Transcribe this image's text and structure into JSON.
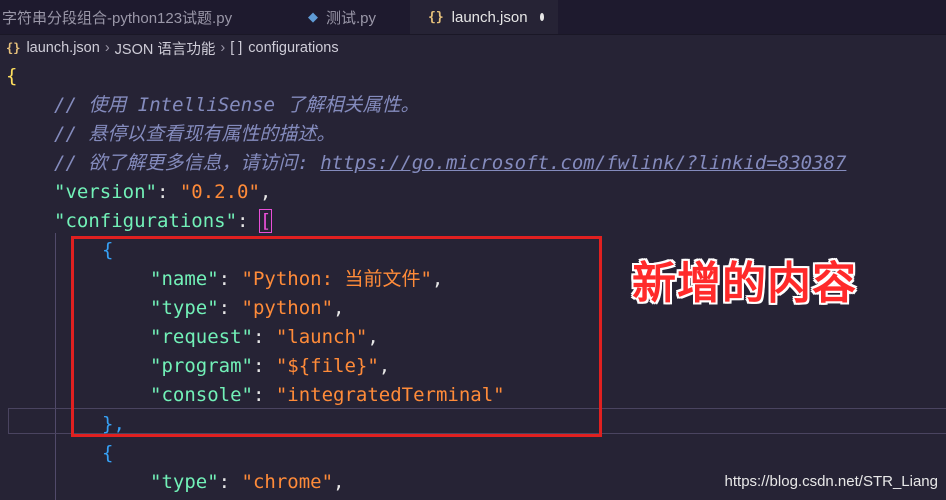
{
  "tabs": [
    {
      "icon": "python-icon",
      "label": "字符串分段组合-python123试题.py",
      "active": false
    },
    {
      "icon": "python-icon",
      "label": "测试.py",
      "active": false
    },
    {
      "icon": "json-icon",
      "label": "launch.json",
      "active": true,
      "unsaved": true
    }
  ],
  "breadcrumb": {
    "file": "launch.json",
    "segment2": "JSON 语言功能",
    "segment3_icon": "[ ]",
    "segment3": "configurations"
  },
  "code": {
    "open_brace": "{",
    "comment1": "// 使用 IntelliSense 了解相关属性。",
    "comment2": "// 悬停以查看现有属性的描述。",
    "comment3_prefix": "// 欲了解更多信息，请访问: ",
    "comment3_link": "https://go.microsoft.com/fwlink/?linkid=830387",
    "version_key": "\"version\"",
    "version_value": "\"0.2.0\"",
    "configurations_key": "\"configurations\"",
    "open_bracket": "[",
    "obj1": {
      "open": "{",
      "name_key": "\"name\"",
      "name_value": "\"Python: 当前文件\"",
      "type_key": "\"type\"",
      "type_value": "\"python\"",
      "request_key": "\"request\"",
      "request_value": "\"launch\"",
      "program_key": "\"program\"",
      "program_value": "\"${file}\"",
      "console_key": "\"console\"",
      "console_value": "\"integratedTerminal\"",
      "close": "},"
    },
    "obj2": {
      "open": "{",
      "type_key": "\"type\"",
      "type_value": "\"chrome\""
    }
  },
  "annotation": "新增的内容",
  "watermark": "https://blog.csdn.net/STR_Liang",
  "colors": {
    "background": "#262335",
    "key": "#72f1b8",
    "string": "#ff8b39",
    "comment": "#848bbd",
    "highlight": "#e02020"
  }
}
